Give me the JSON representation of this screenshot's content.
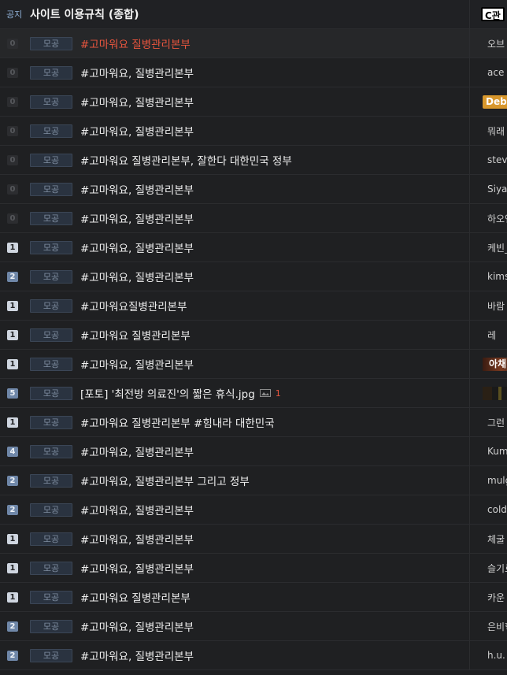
{
  "notice": {
    "label": "공지",
    "title": "사이트 이용규칙 (종합)",
    "author_badge": "C관"
  },
  "rows": [
    {
      "count": "0",
      "category": "모공",
      "title": "#고마워요 질병관리본부",
      "author": "오브",
      "red": true
    },
    {
      "count": "0",
      "category": "모공",
      "title": "#고마워요, 질병관리본부",
      "author": "ace"
    },
    {
      "count": "0",
      "category": "모공",
      "title": "#고마워요, 질병관리본부",
      "author": "Deb",
      "badge": "debug"
    },
    {
      "count": "0",
      "category": "모공",
      "title": "#고마워요, 질병관리본부",
      "author": "뭐래"
    },
    {
      "count": "0",
      "category": "모공",
      "title": "#고마워요 질병관리본부, 잘한다 대한민국 정부",
      "author": "stev"
    },
    {
      "count": "0",
      "category": "모공",
      "title": "#고마워요, 질병관리본부",
      "author": "Siya"
    },
    {
      "count": "0",
      "category": "모공",
      "title": "#고마워요, 질병관리본부",
      "author": "하오엔지"
    },
    {
      "count": "1",
      "category": "모공",
      "title": "#고마워요, 질병관리본부",
      "author": "케빈_k"
    },
    {
      "count": "2",
      "category": "모공",
      "title": "#고마워요, 질병관리본부",
      "author": "kims",
      "hi": true
    },
    {
      "count": "1",
      "category": "모공",
      "title": "#고마워요질병관리본부",
      "author": "바람"
    },
    {
      "count": "1",
      "category": "모공",
      "title": "#고마워요 질병관리본부",
      "author": "레"
    },
    {
      "count": "1",
      "category": "모공",
      "title": "#고마워요, 질병관리본부",
      "author": "아채",
      "badge": "img"
    },
    {
      "count": "5",
      "category": "모공",
      "title": "[포토] '최전방 의료진'의 짧은 휴식.jpg",
      "author": "",
      "badge": "dots",
      "image": true,
      "comments": "1",
      "hi": true
    },
    {
      "count": "1",
      "category": "모공",
      "title": "#고마워요 질병관리본부 #힘내라 대한민국",
      "author": "그런"
    },
    {
      "count": "4",
      "category": "모공",
      "title": "#고마워요, 질병관리본부",
      "author": "Kum",
      "hi": true
    },
    {
      "count": "2",
      "category": "모공",
      "title": "#고마워요, 질병관리본부 그리고 정부",
      "author": "mulgu",
      "hi": true
    },
    {
      "count": "2",
      "category": "모공",
      "title": "#고마워요, 질병관리본부",
      "author": "coldw",
      "hi": true
    },
    {
      "count": "1",
      "category": "모공",
      "title": "#고마워요, 질병관리본부",
      "author": "체굴"
    },
    {
      "count": "1",
      "category": "모공",
      "title": "#고마워요, 질병관리본부",
      "author": "슬기로"
    },
    {
      "count": "1",
      "category": "모공",
      "title": "#고마워요 질병관리본부",
      "author": "카운"
    },
    {
      "count": "2",
      "category": "모공",
      "title": "#고마워요, 질병관리본부",
      "author": "은비학",
      "hi": true
    },
    {
      "count": "2",
      "category": "모공",
      "title": "#고마워요, 질병관리본부",
      "author": "h.u.",
      "hi": true
    }
  ]
}
